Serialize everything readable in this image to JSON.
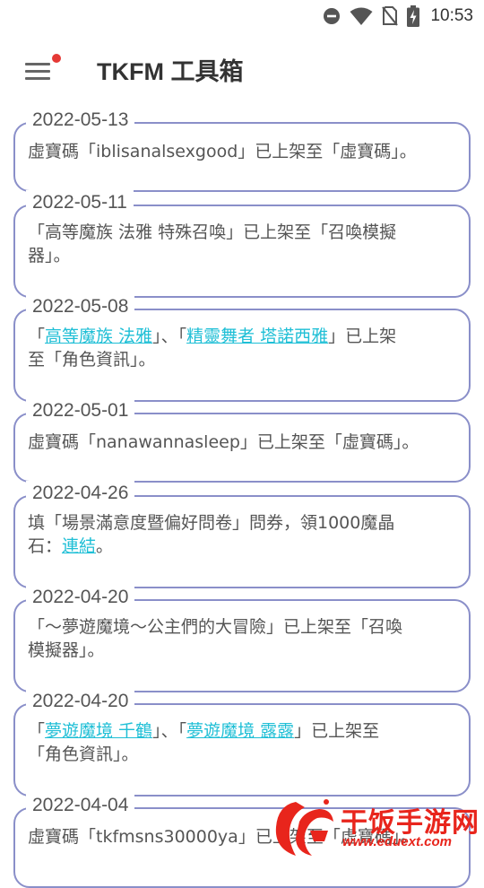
{
  "status_bar": {
    "time": "10:53",
    "icons": [
      "dnd-icon",
      "wifi-icon",
      "no-sim-icon",
      "battery-charging-icon"
    ]
  },
  "app_bar": {
    "title": "TKFM 工具箱",
    "menu_icon": "hamburger-menu-icon",
    "notification_dot_color": "#e53935"
  },
  "colors": {
    "card_border": "#8a8fc9",
    "link": "#1fbfd6",
    "text": "#555555"
  },
  "news": [
    {
      "date": "2022-05-13",
      "parts": [
        {
          "t": "虛寶碼「iblisanalsexgood」已上架至「虛寶碼」。"
        }
      ]
    },
    {
      "date": "2022-05-11",
      "parts": [
        {
          "t": "「高等魔族 法雅 特殊召喚」已上架至「召喚模擬"
        },
        {
          "t": "器」。",
          "br": true
        }
      ]
    },
    {
      "date": "2022-05-08",
      "parts": [
        {
          "t": "「"
        },
        {
          "t": "高等魔族 法雅",
          "link": true
        },
        {
          "t": "」、「"
        },
        {
          "t": "精靈舞者 塔諾西雅",
          "link": true
        },
        {
          "t": "」已上架"
        },
        {
          "t": "至「角色資訊」。",
          "br": true
        }
      ]
    },
    {
      "date": "2022-05-01",
      "parts": [
        {
          "t": "虛寶碼「nanawannasleep」已上架至「虛寶碼」。"
        }
      ]
    },
    {
      "date": "2022-04-26",
      "parts": [
        {
          "t": "填「場景滿意度暨偏好問卷」問券，領1000魔晶"
        },
        {
          "t": "石：",
          "br": true
        },
        {
          "t": "連結",
          "link": true
        },
        {
          "t": "。"
        }
      ]
    },
    {
      "date": "2022-04-20",
      "parts": [
        {
          "t": "「〜夢遊魔境〜公主們的大冒險」已上架至「召喚"
        },
        {
          "t": "模擬器」。",
          "br": true
        }
      ]
    },
    {
      "date": "2022-04-20",
      "parts": [
        {
          "t": "「"
        },
        {
          "t": "夢遊魔境 千鶴",
          "link": true
        },
        {
          "t": "」、「"
        },
        {
          "t": "夢遊魔境 露露",
          "link": true
        },
        {
          "t": "」已上架至"
        },
        {
          "t": "「角色資訊」。",
          "br": true
        }
      ]
    },
    {
      "date": "2022-04-04",
      "parts": [
        {
          "t": "虛寶碼「tkfmsns30000ya」已上架至「虛寶碼」。"
        }
      ]
    }
  ],
  "watermark": {
    "name": "干饭手游网",
    "url": "www.eduext.com"
  }
}
